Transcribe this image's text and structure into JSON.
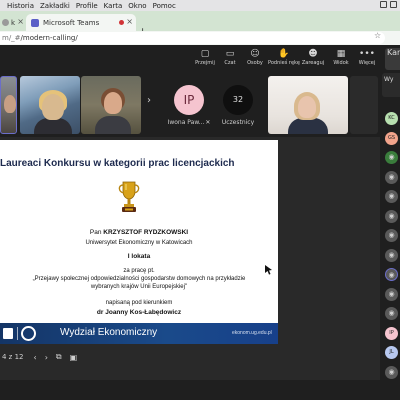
{
  "menubar": {
    "items": [
      "Historia",
      "Zakładki",
      "Profile",
      "Karta",
      "Okno",
      "Pomoc"
    ]
  },
  "browser": {
    "tabs": [
      {
        "label": "k",
        "close": "×"
      },
      {
        "label": "Microsoft Teams",
        "close": "×",
        "recording": true
      }
    ],
    "newtab": "+",
    "url_prefix": "m/_#",
    "url_path": "/modern-calling/",
    "star": "☆"
  },
  "teams_toolbar": {
    "buttons": [
      {
        "icon": "▢",
        "label": "Przejmij"
      },
      {
        "icon": "▭",
        "label": "Czat"
      },
      {
        "icon": "☺",
        "label": "Osoby"
      },
      {
        "icon": "✋",
        "label": "Podnieś rękę"
      },
      {
        "icon": "☻",
        "label": "Zareaguj"
      },
      {
        "icon": "▦",
        "label": "Widok"
      },
      {
        "icon": "•••",
        "label": "Więcej"
      }
    ],
    "camera_label": "Kam"
  },
  "gallery": {
    "participants": [
      {
        "initials": "IP",
        "name": "Iwona Paw..."
      },
      {
        "initials": "32",
        "name": "Uczestnicy"
      }
    ],
    "more": "›",
    "mic_off": "✕"
  },
  "slide": {
    "title": "Laureaci Konkursu w kategorii prac licencjackich",
    "name_prefix": "Pan ",
    "name": "KRZYSZTOF RYDZKOWSKI",
    "university": "Uniwersytet Ekonomiczny w Katowicach",
    "place": "I lokata",
    "for_work": "za pracę pt.",
    "topic_line1": "„Przejawy społecznej odpowiedzialności gospodarstw domowych na przykładzie",
    "topic_line2": "wybranych krajów Unii Europejskiej\"",
    "supervisor_label": "napisaną pod kierunkiem",
    "supervisor": "dr Joanny Kos-Łabędowicz",
    "footer_title": "Wydział Ekonomiczny",
    "footer_url": "ekonom.ug.edu.pl"
  },
  "pager": {
    "count": "4 z 12",
    "prev": "‹",
    "next": "›"
  },
  "rail": {
    "panel_label": "Wy",
    "avatars": [
      {
        "initials": "KC",
        "color": "#b8e0b0"
      },
      {
        "initials": "GS",
        "color": "#f2a48c"
      },
      {
        "initials": "",
        "color": "#3a7d3c"
      },
      {
        "initials": "",
        "color": "#5a5a5a"
      },
      {
        "initials": "",
        "color": "#5a5a5a"
      },
      {
        "initials": "",
        "color": "#5a5a5a"
      },
      {
        "initials": "",
        "color": "#5a5a5a"
      },
      {
        "initials": "",
        "color": "#5a5a5a"
      },
      {
        "initials": "",
        "color": "#5a5a5a"
      },
      {
        "initials": "",
        "color": "#5a5a5a"
      },
      {
        "initials": "",
        "color": "#5a5a5a"
      },
      {
        "initials": "IP",
        "color": "#f5c4cf"
      },
      {
        "initials": "JL",
        "color": "#b7c8ef"
      },
      {
        "initials": "",
        "color": "#5a5a5a"
      }
    ]
  },
  "colors": {
    "teams_accent": "#5b5fc7",
    "slide_title": "#1d2a4e",
    "footer_blue": "#143566"
  }
}
